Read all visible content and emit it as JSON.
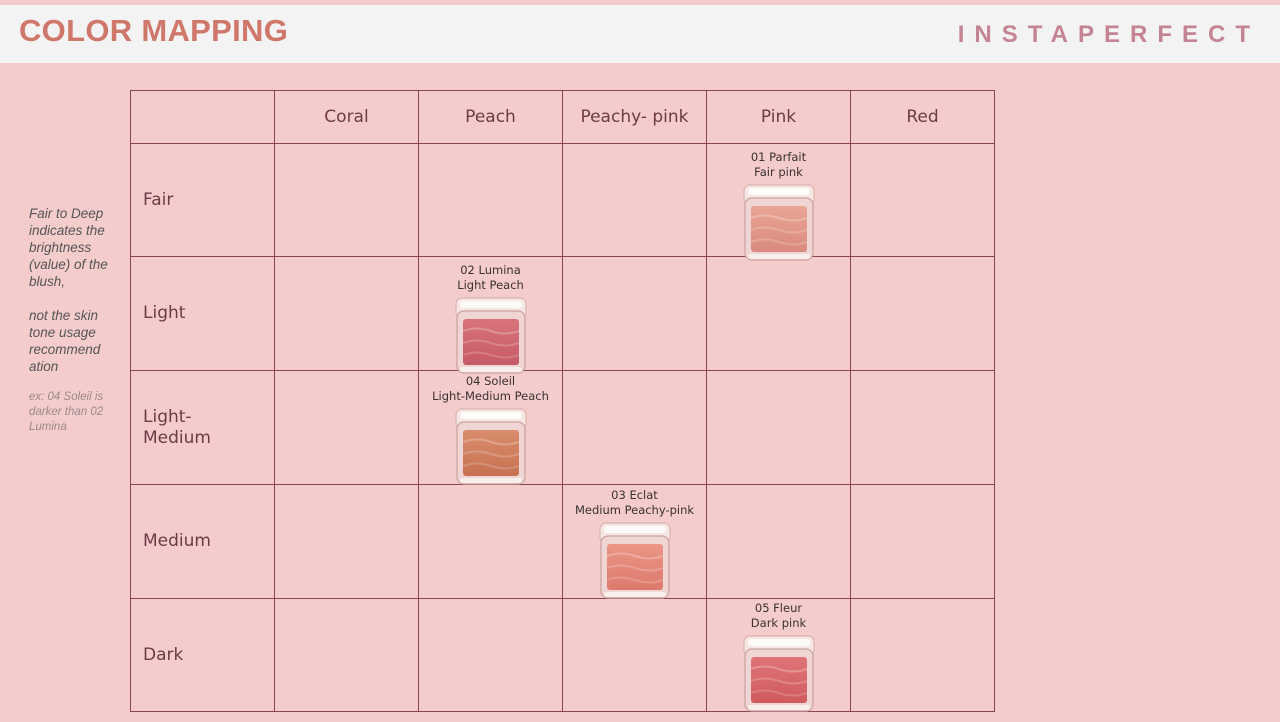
{
  "header": {
    "title": "COLOR MAPPING",
    "brand": "INSTAPERFECT"
  },
  "note": {
    "line1": "Fair to Deep indicates the brightness (value) of the blush,",
    "line2": "not the skin tone usage recommend ation",
    "example": "ex: 04 Soleil is darker than 02 Lumina"
  },
  "table": {
    "columns": [
      "Coral",
      "Peach",
      "Peachy- pink",
      "Pink",
      "Red"
    ],
    "rows": [
      "Fair",
      "Light",
      "Light-\nMedium",
      "Medium",
      "Dark"
    ]
  },
  "products": [
    {
      "name": "01 Parfait",
      "shade": "Fair pink",
      "icon": "blush-compact-icon",
      "pan_color": "#d98a7e",
      "pan_light": "#eaa595"
    },
    {
      "name": "02 Lumina",
      "shade": "Light Peach",
      "icon": "blush-compact-icon",
      "pan_color": "#c65a66",
      "pan_light": "#d8737b"
    },
    {
      "name": "04 Soleil",
      "shade": "Light-Medium Peach",
      "icon": "blush-compact-icon",
      "pan_color": "#c77152",
      "pan_light": "#d98d6c"
    },
    {
      "name": "03 Eclat",
      "shade": "Medium Peachy-pink",
      "icon": "blush-compact-icon",
      "pan_color": "#dc7a6c",
      "pan_light": "#ec9686"
    },
    {
      "name": "05 Fleur",
      "shade": "Dark pink",
      "icon": "blush-compact-icon",
      "pan_color": "#cf5a5e",
      "pan_light": "#e07478"
    }
  ],
  "colors": {
    "background": "#f4cccc",
    "header_bg": "#f3f3f3",
    "title": "#d0776c",
    "brand": "#c48494",
    "grid_line": "#8a4553"
  }
}
